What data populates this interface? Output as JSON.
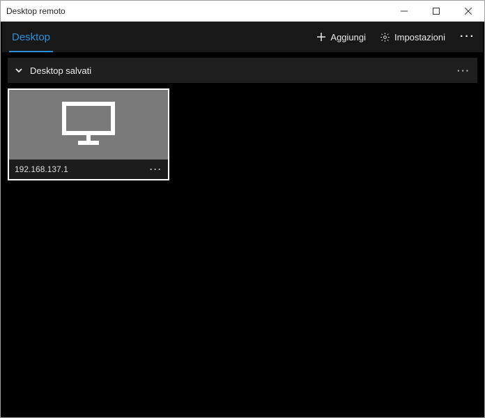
{
  "window": {
    "title": "Desktop remoto"
  },
  "commandBar": {
    "activeTab": "Desktop",
    "add": "Aggiungi",
    "settings": "Impostazioni"
  },
  "group": {
    "title": "Desktop salvati"
  },
  "tiles": [
    {
      "name": "192.168.137.1"
    }
  ],
  "icons": {
    "plus": "plus",
    "gear": "gear",
    "chevronDown": "chevron-down",
    "more": "more",
    "monitor": "monitor"
  }
}
